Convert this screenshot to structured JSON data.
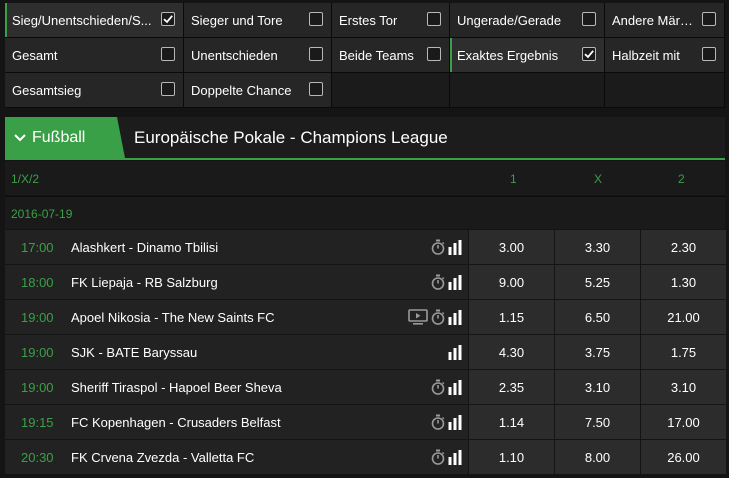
{
  "filters": [
    {
      "label": "Sieg/Unentschieden/S...",
      "checked": true,
      "active": true
    },
    {
      "label": "Sieger und Tore",
      "checked": false,
      "active": false
    },
    {
      "label": "Erstes Tor",
      "checked": false,
      "active": false
    },
    {
      "label": "Ungerade/Gerade",
      "checked": false,
      "active": false
    },
    {
      "label": "Andere Märkte",
      "checked": false,
      "active": false
    },
    {
      "label": "Gesamt",
      "checked": false,
      "active": false
    },
    {
      "label": "Unentschieden",
      "checked": false,
      "active": false
    },
    {
      "label": "Beide Teams",
      "checked": false,
      "active": false
    },
    {
      "label": "Exaktes Ergebnis",
      "checked": true,
      "active": true
    },
    {
      "label": "Halbzeit mit",
      "checked": false,
      "active": false
    },
    {
      "label": "Gesamtsieg",
      "checked": false,
      "active": false
    },
    {
      "label": "Doppelte Chance",
      "checked": false,
      "active": false
    }
  ],
  "sport": {
    "name": "Fußball",
    "league": "Europäische Pokale - Champions League"
  },
  "table": {
    "market": "1/X/2",
    "col1": "1",
    "colx": "X",
    "col2": "2",
    "date": "2016-07-19"
  },
  "matches": [
    {
      "time": "17:00",
      "name": "Alashkert - Dinamo Tbilisi",
      "tv": false,
      "timer": true,
      "o1": "3.00",
      "ox": "3.30",
      "o2": "2.30"
    },
    {
      "time": "18:00",
      "name": "FK Liepaja - RB Salzburg",
      "tv": false,
      "timer": true,
      "o1": "9.00",
      "ox": "5.25",
      "o2": "1.30"
    },
    {
      "time": "19:00",
      "name": "Apoel Nikosia - The New Saints FC",
      "tv": true,
      "timer": true,
      "o1": "1.15",
      "ox": "6.50",
      "o2": "21.00"
    },
    {
      "time": "19:00",
      "name": "SJK - BATE Baryssau",
      "tv": false,
      "timer": false,
      "o1": "4.30",
      "ox": "3.75",
      "o2": "1.75"
    },
    {
      "time": "19:00",
      "name": "Sheriff Tiraspol - Hapoel Beer Sheva",
      "tv": false,
      "timer": true,
      "o1": "2.35",
      "ox": "3.10",
      "o2": "3.10"
    },
    {
      "time": "19:15",
      "name": "FC Kopenhagen - Crusaders Belfast",
      "tv": false,
      "timer": true,
      "o1": "1.14",
      "ox": "7.50",
      "o2": "17.00"
    },
    {
      "time": "20:30",
      "name": "FK Crvena Zvezda - Valletta FC",
      "tv": false,
      "timer": true,
      "o1": "1.10",
      "ox": "8.00",
      "o2": "26.00"
    }
  ],
  "icons": {
    "checkbox": "check-icon",
    "sport": "chevron-down-icon",
    "timer": "stopwatch-icon",
    "stats": "bar-chart-icon",
    "tv": "tv-stream-icon"
  },
  "colors": {
    "accent": "#3aa047",
    "background": "#141414",
    "odds_bg": "#2c2c2c"
  }
}
